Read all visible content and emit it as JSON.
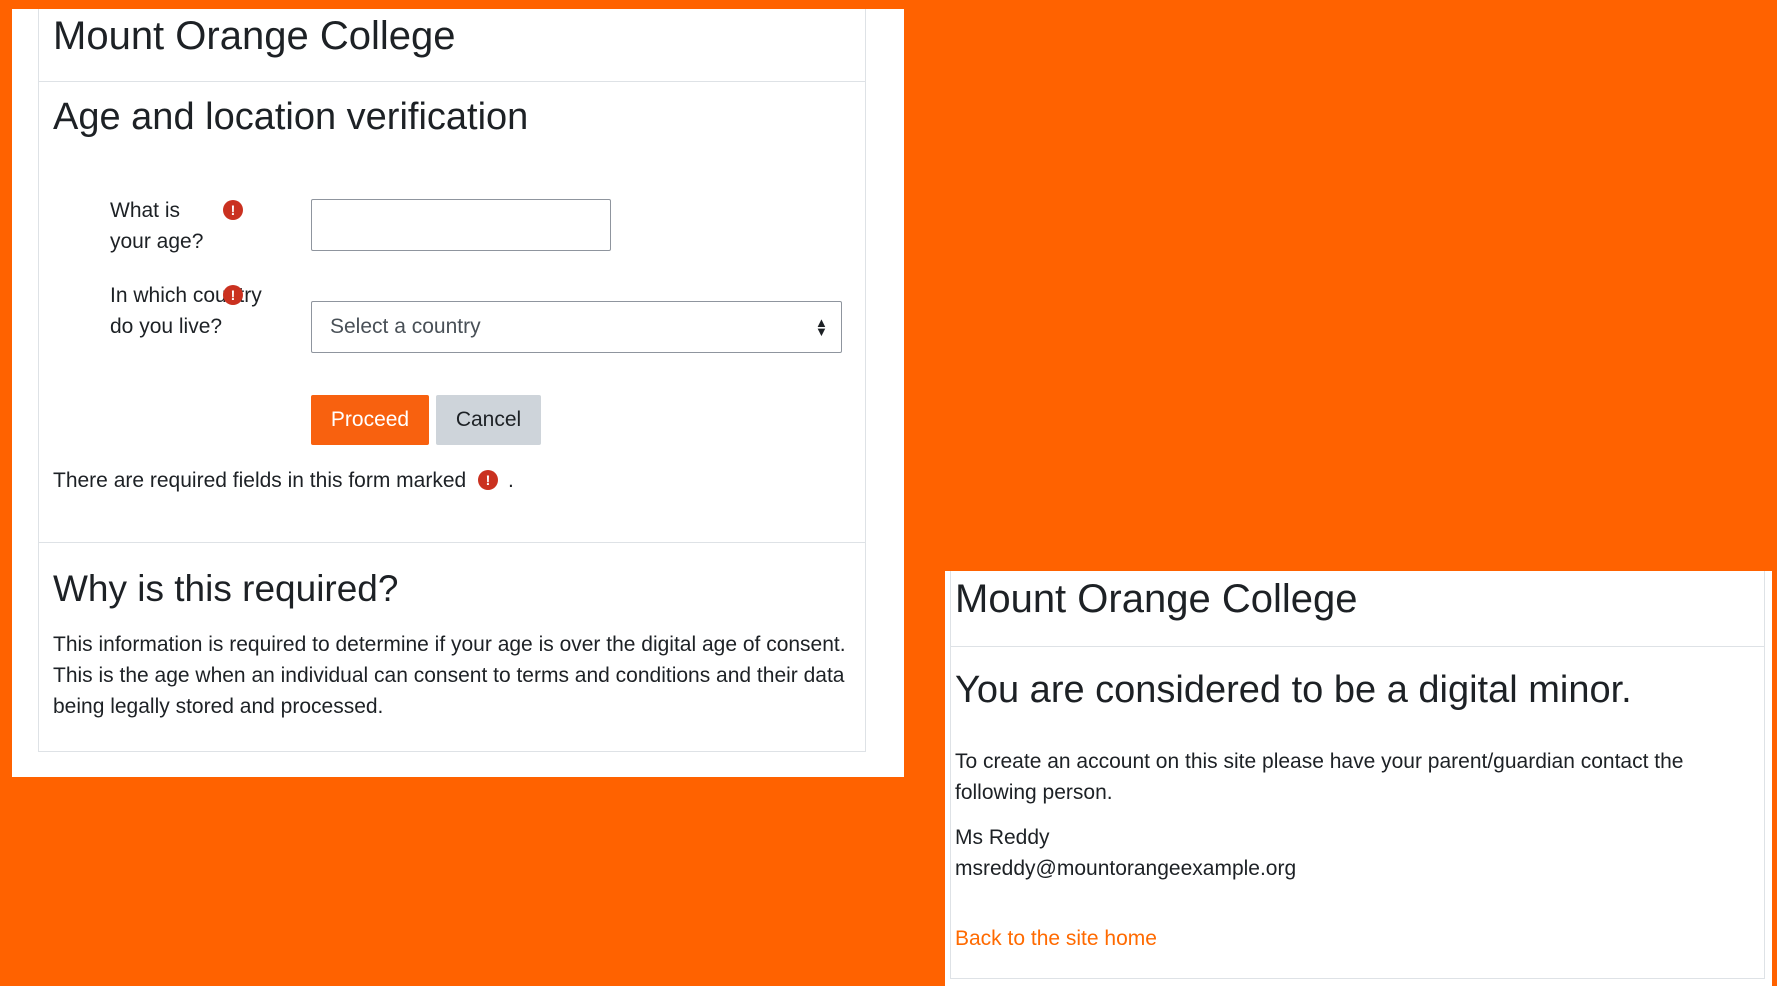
{
  "theme": {
    "accent": "#ff6200",
    "button_primary": "#f8610f",
    "required_icon_color": "#ca3120",
    "link_color": "#ff6a00"
  },
  "left_panel": {
    "site_title": "Mount Orange College",
    "heading": "Age and location verification",
    "age_field": {
      "label": "What is your age?",
      "value": "",
      "required_icon": "exclamation-circle-icon"
    },
    "country_field": {
      "label": "In which country do you live?",
      "selected": "Select a country",
      "required_icon": "exclamation-circle-icon"
    },
    "proceed_label": "Proceed",
    "cancel_label": "Cancel",
    "required_note": "There are required fields in this form marked",
    "required_note_end": ".",
    "why_heading": "Why is this required?",
    "why_text": "This information is required to determine if your age is over the digital age of consent. This is the age when an individual can consent to terms and conditions and their data being legally stored and processed."
  },
  "right_panel": {
    "site_title": "Mount Orange College",
    "heading": "You are considered to be a digital minor.",
    "message": "To create an account on this site please have your parent/guardian contact the following person.",
    "contact_name": "Ms Reddy",
    "contact_email": "msreddy@mountorangeexample.org",
    "back_link": "Back to the site home"
  }
}
